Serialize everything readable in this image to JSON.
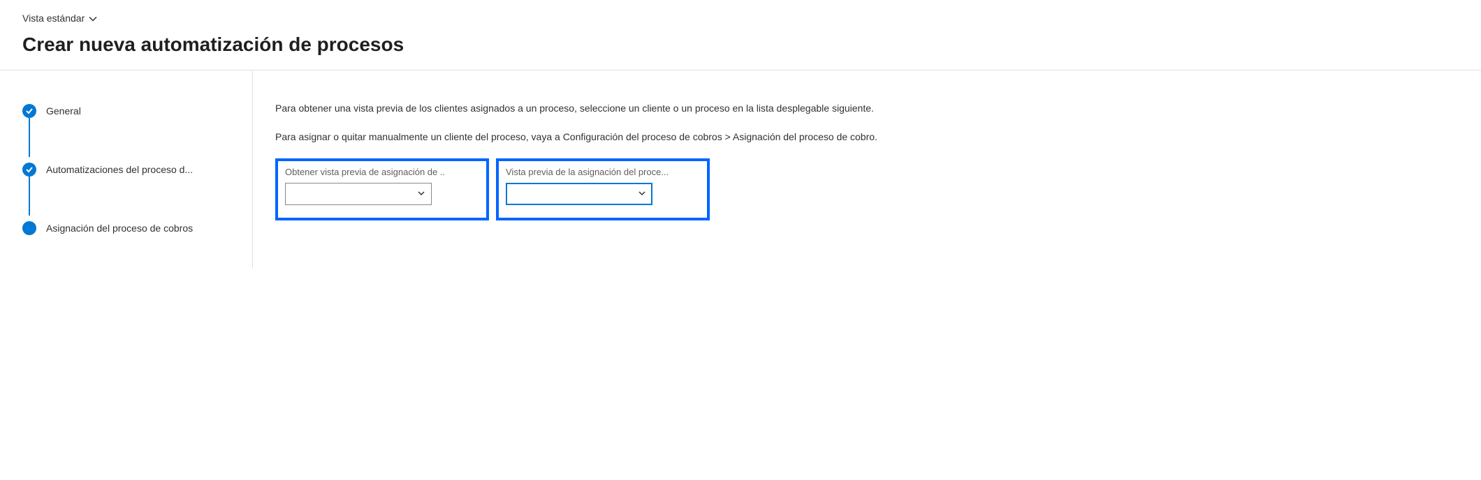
{
  "header": {
    "view_selector": "Vista estándar",
    "page_title": "Crear nueva automatización de procesos"
  },
  "sidebar": {
    "steps": [
      {
        "label": "General",
        "state": "completed"
      },
      {
        "label": "Automatizaciones del proceso d...",
        "state": "completed"
      },
      {
        "label": "Asignación del proceso de cobros",
        "state": "current"
      }
    ]
  },
  "main": {
    "instruction1": "Para obtener una vista previa de los clientes asignados a un proceso, seleccione un cliente o un proceso en la lista desplegable siguiente.",
    "instruction2": "Para asignar o quitar manualmente un cliente del proceso, vaya a Configuración del proceso de cobros > Asignación del proceso de cobro.",
    "fields": [
      {
        "label": "Obtener vista previa de asignación de ..",
        "value": ""
      },
      {
        "label": "Vista previa de la asignación del proce...",
        "value": ""
      }
    ]
  }
}
